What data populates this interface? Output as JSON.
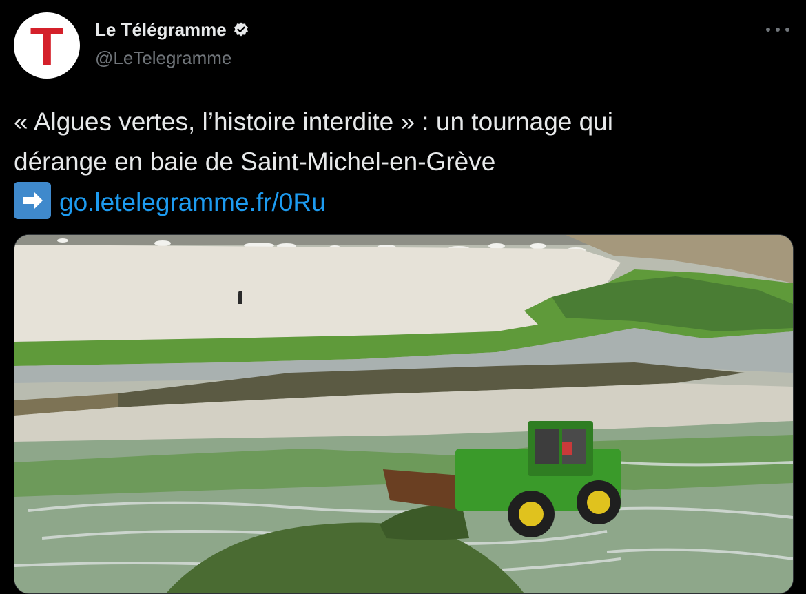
{
  "account": {
    "display_name": "Le Télégramme",
    "handle": "@LeTelegramme",
    "avatar_letter": "T",
    "verified": true
  },
  "tweet": {
    "text_line1": "« Algues vertes, l’histoire interdite » : un tournage qui",
    "text_line2": "dérange en baie de Saint-Michel-en-Grève",
    "link_text": "go.letelegramme.fr/0Ru"
  },
  "icons": {
    "verified": "verified-badge-icon",
    "more": "more-options-icon",
    "arrow": "right-arrow-emoji-icon"
  },
  "colors": {
    "background": "#000000",
    "text": "#e7e9ea",
    "secondary_text": "#71767b",
    "link": "#1d9bf0",
    "logo_red": "#d4202a"
  },
  "media": {
    "kind": "photo"
  }
}
